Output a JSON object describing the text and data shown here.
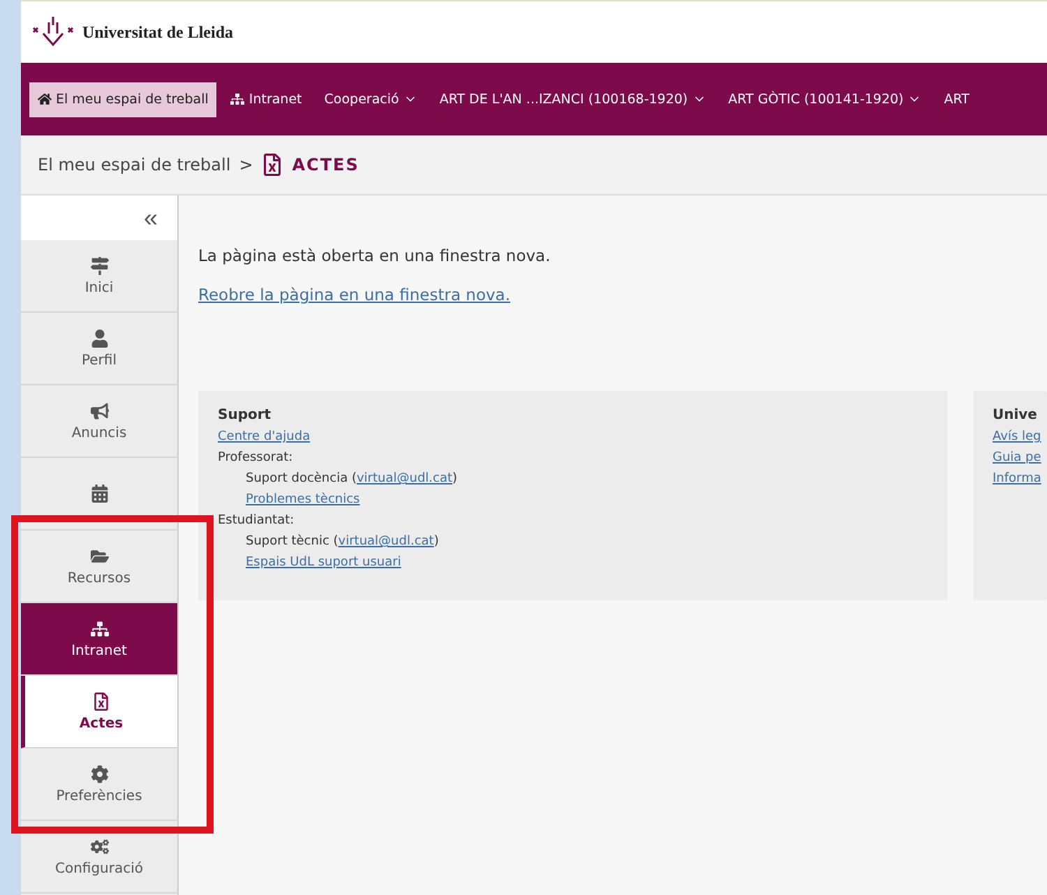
{
  "header": {
    "title": "Universitat de Lleida"
  },
  "nav": [
    {
      "label": "El meu espai de treball",
      "dropdown": false,
      "selected": true
    },
    {
      "label": "Intranet",
      "dropdown": false,
      "selected": false
    },
    {
      "label": "Cooperació",
      "dropdown": true,
      "selected": false
    },
    {
      "label": "ART DE L'AN ...IZANCI (100168-1920)",
      "dropdown": true,
      "selected": false
    },
    {
      "label": "ART GÒTIC (100141-1920)",
      "dropdown": true,
      "selected": false
    },
    {
      "label": "ART",
      "dropdown": false,
      "selected": false
    }
  ],
  "breadcrumb": {
    "parent": "El meu espai de treball",
    "separator": ">",
    "current": "ACTES"
  },
  "sidebar": {
    "collapse": "«",
    "items": [
      {
        "kind": "item",
        "label": "Inici",
        "selected": false
      },
      {
        "kind": "item",
        "label": "Perfil",
        "selected": false
      },
      {
        "kind": "item",
        "label": "Anuncis",
        "selected": false
      },
      {
        "kind": "item",
        "selected": false
      },
      {
        "kind": "item",
        "label": "Recursos",
        "selected": false
      },
      {
        "kind": "item",
        "label": "Intranet",
        "selected": true
      },
      {
        "kind": "subitem",
        "label": "Actes",
        "selected": true
      },
      {
        "kind": "item",
        "label": "Preferències",
        "selected": false
      },
      {
        "kind": "item",
        "label": "Configuració",
        "selected": false
      }
    ]
  },
  "content": {
    "message": "La pàgina està oberta en una finestra nova.",
    "link": "Reobre la pàgina en una finestra nova."
  },
  "footer": {
    "support": {
      "title": "Suport",
      "lines": [
        {
          "kind": "link",
          "text": "Centre d'ajuda"
        },
        {
          "kind": "text",
          "text": "Professorat:",
          "children": [
            {
              "kind": "mail",
              "text": "Suport docència (",
              "link": "virtual@udl.cat",
              "after": ")"
            },
            {
              "kind": "link",
              "text": "Problemes tècnics"
            }
          ]
        },
        {
          "kind": "text",
          "text": "Estudiantat:",
          "children": [
            {
              "kind": "mail",
              "text": "Suport tècnic (",
              "link": "virtual@udl.cat",
              "after": ")"
            },
            {
              "kind": "link",
              "text": "Espais UdL suport usuari"
            }
          ]
        }
      ]
    },
    "university": {
      "title": "Unive",
      "links": [
        "Avís leg",
        "Guia pe",
        "Informa"
      ]
    }
  },
  "highlight": {
    "color": "#e0141e"
  }
}
